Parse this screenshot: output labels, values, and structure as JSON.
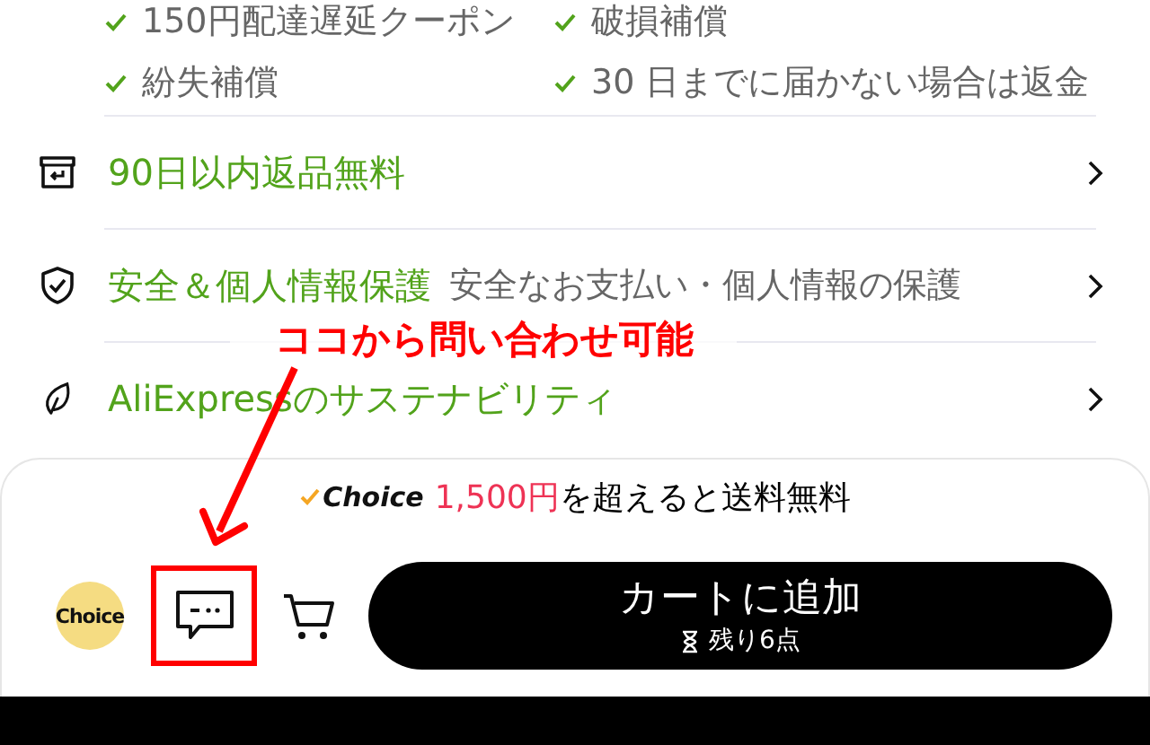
{
  "guarantees": [
    "150円配達遅延クーポン",
    "破損補償",
    "紛失補償",
    "30 日までに届かない場合は返金"
  ],
  "info_rows": [
    {
      "kind": "returns",
      "title": "90日以内返品無料"
    },
    {
      "kind": "security",
      "title": "安全＆個人情報保護",
      "subtitle": "安全なお支払い・個人情報の保護"
    },
    {
      "kind": "sustainability",
      "title": "AliExpressのサステナビリティ"
    }
  ],
  "shipping_banner": {
    "brand": "Choice",
    "amount": "1,500円",
    "text": "を超えると送料無料"
  },
  "bottom_bar": {
    "choice_badge": "Choice",
    "add_to_cart": "カートに追加",
    "stock": "残り6点"
  },
  "annotation": {
    "text": "ココから問い合わせ可能"
  }
}
